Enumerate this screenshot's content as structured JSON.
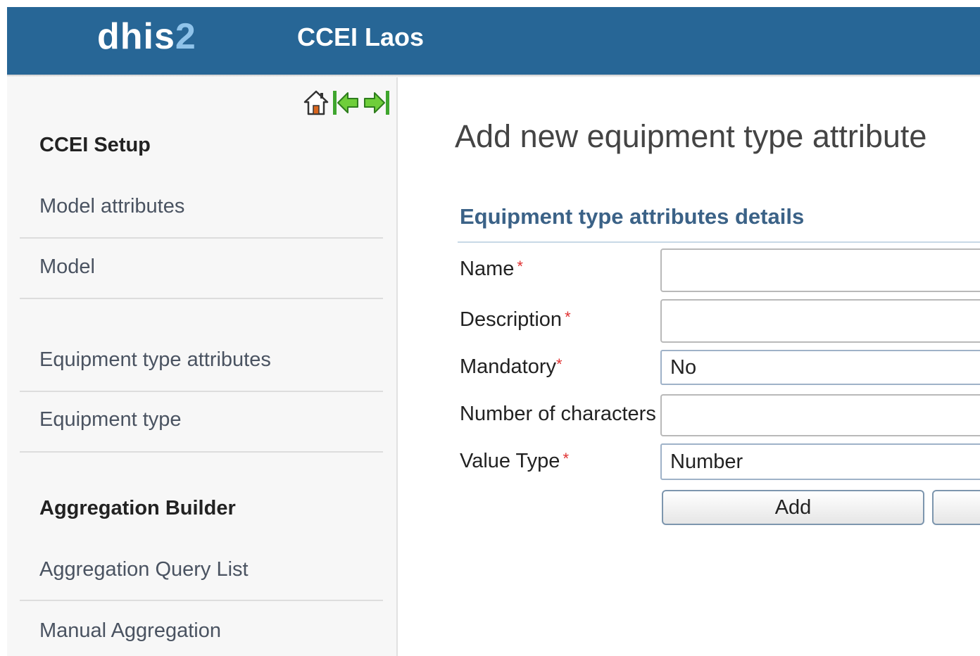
{
  "header": {
    "logo_main": "dhis",
    "logo_accent": "2",
    "app_title": "CCEI Laos"
  },
  "sidebar": {
    "section1": "CCEI Setup",
    "item_model_attributes": "Model attributes",
    "item_model": "Model",
    "item_equipment_type_attributes": "Equipment type attributes",
    "item_equipment_type": "Equipment type",
    "section2": "Aggregation Builder",
    "item_aggregation_query_list": "Aggregation Query List",
    "item_manual_aggregation": "Manual Aggregation"
  },
  "main": {
    "title": "Add new equipment type attribute",
    "form_heading": "Equipment type attributes details",
    "fields": {
      "name_label": "Name",
      "name_value": "",
      "description_label": "Description",
      "description_value": "",
      "mandatory_label": "Mandatory",
      "mandatory_value": "No",
      "num_chars_label": "Number of characters",
      "num_chars_value": "",
      "value_type_label": "Value Type",
      "value_type_value": "Number"
    },
    "required_marker": "*",
    "add_button": "Add",
    "second_button": ""
  },
  "colors": {
    "header_bg": "#276696",
    "logo_accent": "#8fc3ea",
    "heading_blue": "#3b6287",
    "required_red": "#e03030"
  },
  "icons": [
    "home-icon",
    "first-page-icon",
    "last-page-icon"
  ]
}
